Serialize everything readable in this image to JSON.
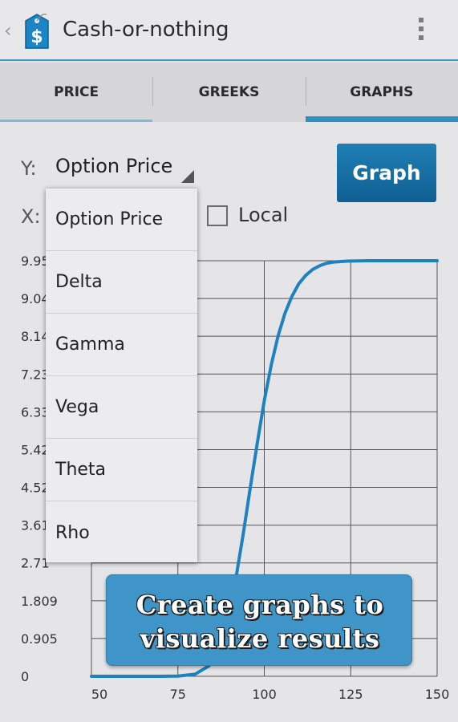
{
  "app": {
    "title": "Cash-or-nothing",
    "back_icon": "chevron-left-icon",
    "app_icon": "price-tag-dollar-icon",
    "overflow_icon": "overflow-menu-icon"
  },
  "tabs": [
    {
      "label": "PRICE",
      "selected": false
    },
    {
      "label": "GREEKS",
      "selected": false
    },
    {
      "label": "GRAPHS",
      "selected": true
    }
  ],
  "controls": {
    "y_label": "Y:",
    "y_selected": "Option Price",
    "x_label": "X:",
    "graph_button": "Graph",
    "local_label": "Local",
    "local_checked": false
  },
  "dropdown": {
    "options": [
      "Option Price",
      "Delta",
      "Gamma",
      "Vega",
      "Theta",
      "Rho"
    ]
  },
  "chart_data": {
    "type": "line",
    "y_tick_labels": [
      "9.95",
      "9.04",
      "8.14",
      "7.23",
      "6.33",
      "5.42",
      "4.52",
      "3.61",
      "2.71",
      "1.809",
      "0.905",
      "0"
    ],
    "x_tick_labels": [
      "50",
      "75",
      "100",
      "125",
      "150"
    ],
    "xlim": [
      50,
      150
    ],
    "ylim": [
      0,
      9.95
    ],
    "grid": true,
    "line_color": "#1f82c0",
    "series": [
      {
        "x": [
          50,
          60,
          70,
          75,
          80,
          84,
          86,
          88,
          90,
          92,
          94,
          96,
          98,
          100,
          102,
          104,
          106,
          108,
          110,
          112,
          114,
          116,
          118,
          120,
          124,
          130,
          140,
          150
        ],
        "values": [
          0,
          0,
          0,
          0.005,
          0.05,
          0.25,
          0.5,
          0.95,
          1.6,
          2.45,
          3.45,
          4.55,
          5.6,
          6.6,
          7.45,
          8.15,
          8.7,
          9.1,
          9.4,
          9.6,
          9.74,
          9.83,
          9.89,
          9.92,
          9.94,
          9.95,
          9.95,
          9.95
        ]
      }
    ]
  },
  "banner": {
    "line1": "Create graphs to",
    "line2": "visualize results"
  },
  "colors": {
    "accent": "#2e8fc4",
    "button": "#1a76ab",
    "banner": "#3f95c8"
  }
}
